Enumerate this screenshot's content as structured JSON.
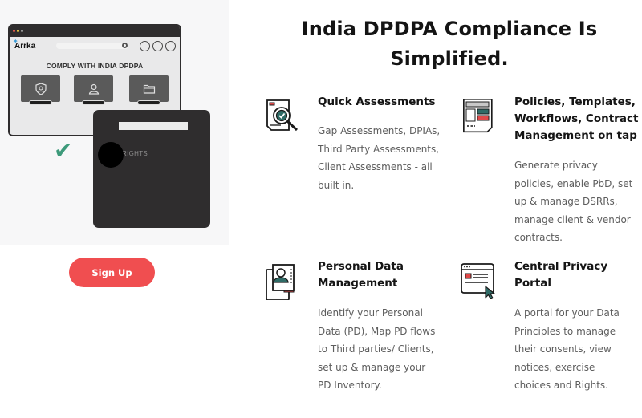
{
  "hero": {
    "browser": {
      "logo_text": "Arrka",
      "heading": "COMPLY WITH INDIA DPDPA",
      "dot_colors": [
        "#e05a4f",
        "#e8c542",
        "#9a9a9a"
      ],
      "tiles": [
        {
          "icon": "shield-user-icon"
        },
        {
          "icon": "user-icon"
        },
        {
          "icon": "folder-icon"
        }
      ]
    },
    "rights_card": {
      "label": "RIGHTS"
    },
    "check_icon": "checkmark-icon"
  },
  "signup": {
    "label": "Sign Up",
    "color": "#f04e50"
  },
  "headline": {
    "line1": "India DPDPA Compliance Is",
    "line2": "Simplified."
  },
  "features": [
    {
      "icon": "magnifier-check-icon",
      "title": "Quick Assessments",
      "desc": [
        "Gap Assessments, DPIAs,",
        "Third Party Assessments,",
        "Client Assessments - all",
        "built in."
      ]
    },
    {
      "icon": "document-template-icon",
      "title": [
        "Policies, Templates,",
        "Workflows, Contract",
        "Management on tap"
      ],
      "desc": [
        "Generate privacy",
        "policies, enable PbD, set",
        "up & manage DSRRs,",
        "manage client & vendor",
        "contracts."
      ]
    },
    {
      "icon": "profile-document-icon",
      "title": [
        "Personal Data",
        "Management"
      ],
      "desc": [
        "Identify your Personal",
        "Data (PD), Map PD flows",
        "to Third parties/ Clients,",
        "set up & manage your",
        "PD Inventory."
      ]
    },
    {
      "icon": "portal-cursor-icon",
      "title": [
        "Central Privacy",
        "Portal"
      ],
      "desc": [
        "A portal for your Data",
        "Principles to manage",
        "their consents, view",
        "notices, exercise",
        "choices and Rights."
      ]
    }
  ],
  "colors": {
    "accent_red": "#e04848",
    "accent_teal": "#2f6b66",
    "check_green": "#3d9a7a"
  }
}
